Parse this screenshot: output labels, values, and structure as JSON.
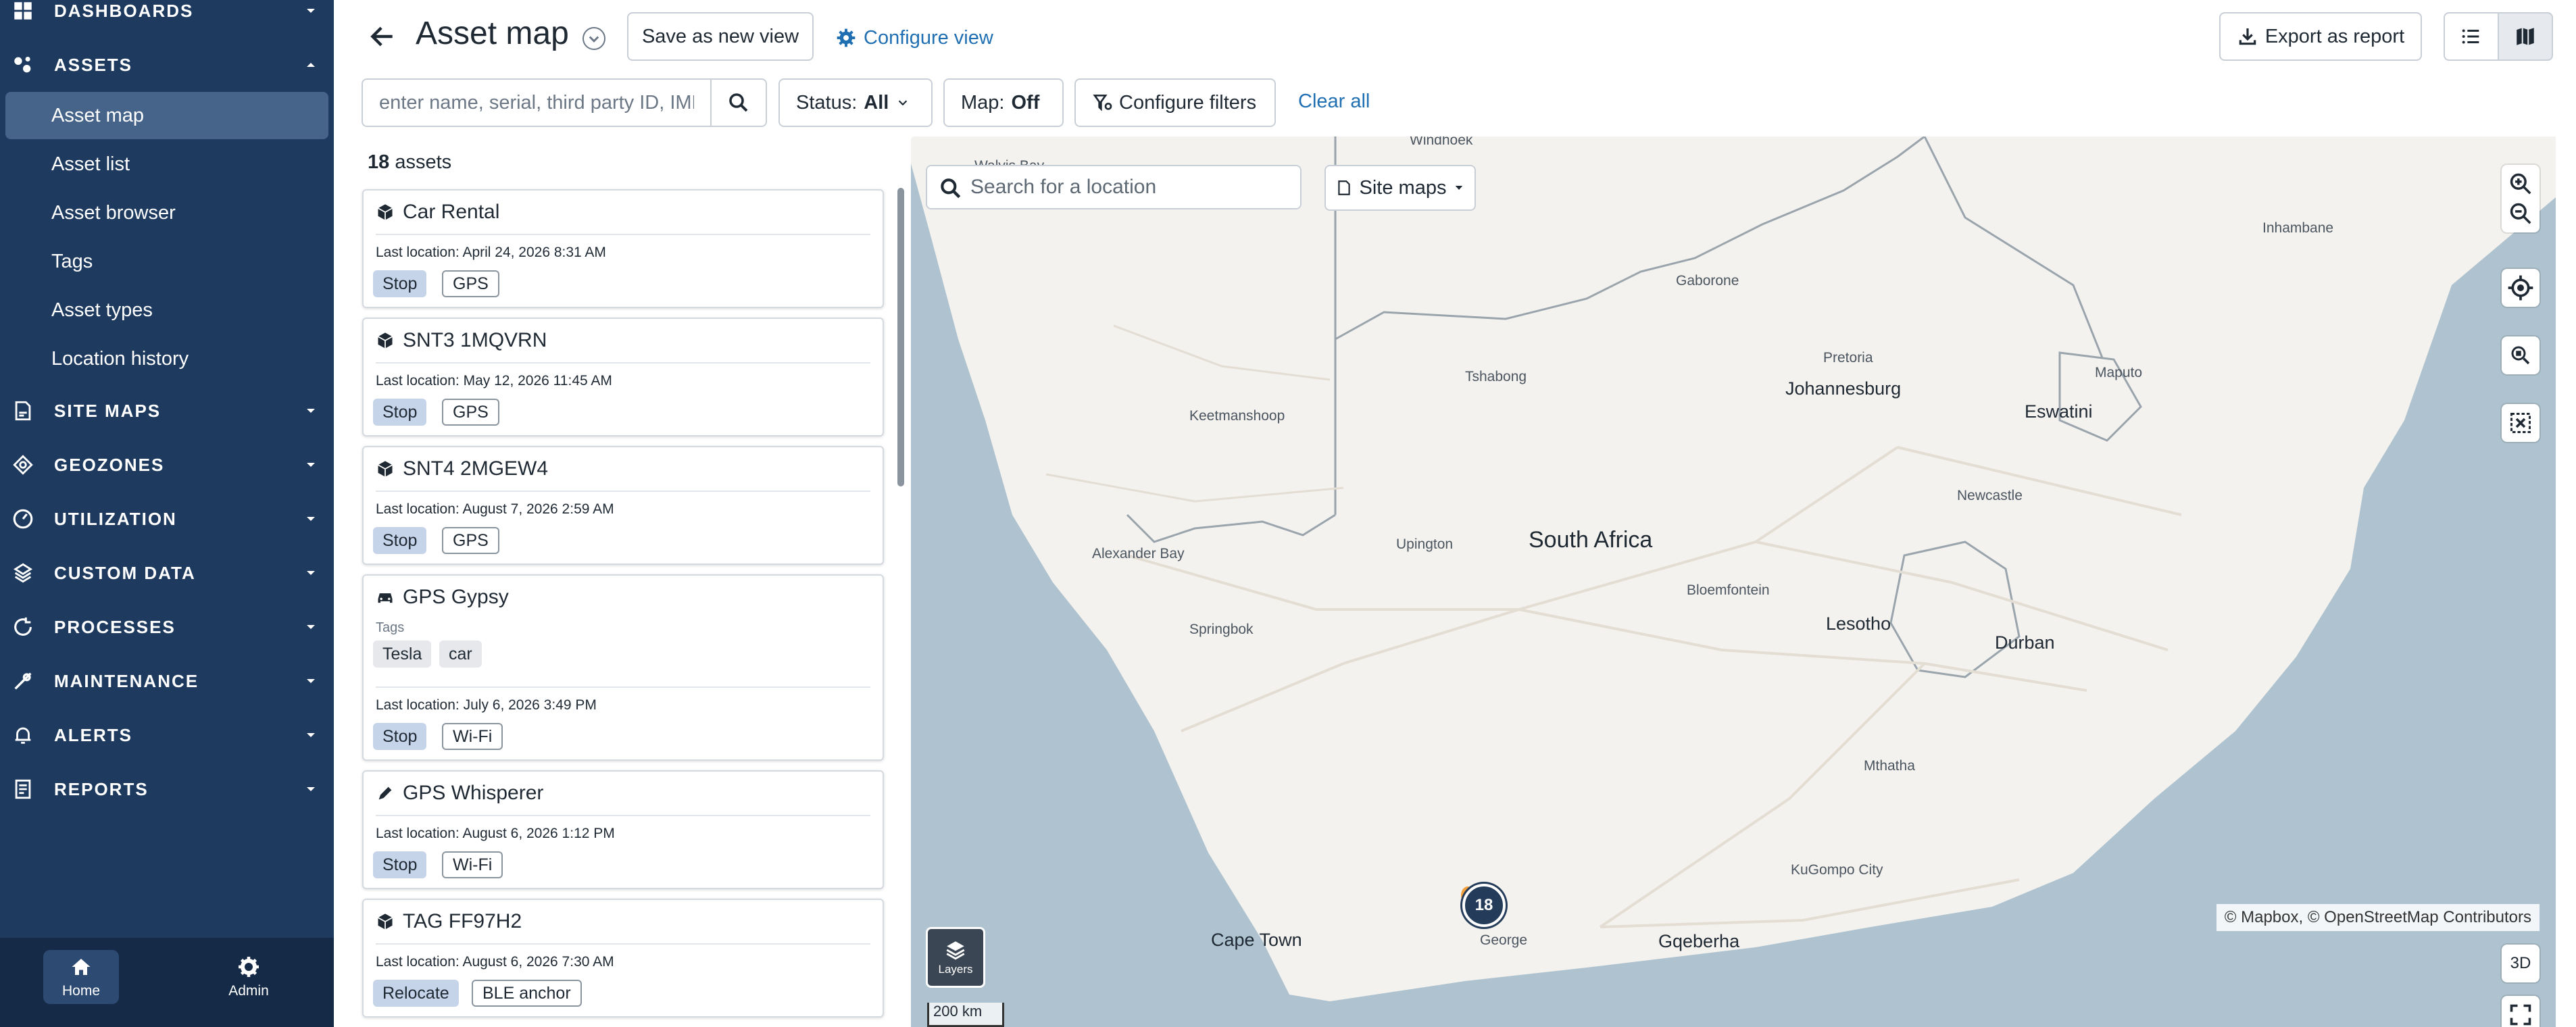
{
  "sidebar": {
    "sections": [
      {
        "key": "dashboards",
        "label": "DASHBOARDS",
        "icon": "grid-icon"
      },
      {
        "key": "assets",
        "label": "ASSETS",
        "icon": "assets-icon"
      },
      {
        "key": "site_maps",
        "label": "SITE MAPS",
        "icon": "site-maps-icon"
      },
      {
        "key": "geozones",
        "label": "GEOZONES",
        "icon": "geozones-icon"
      },
      {
        "key": "utilization",
        "label": "UTILIZATION",
        "icon": "utilization-icon"
      },
      {
        "key": "custom_data",
        "label": "CUSTOM DATA",
        "icon": "custom-data-icon"
      },
      {
        "key": "processes",
        "label": "PROCESSES",
        "icon": "processes-icon"
      },
      {
        "key": "maintenance",
        "label": "MAINTENANCE",
        "icon": "wrench-icon"
      },
      {
        "key": "alerts",
        "label": "ALERTS",
        "icon": "bell-icon"
      },
      {
        "key": "reports",
        "label": "REPORTS",
        "icon": "report-icon"
      }
    ],
    "asset_items": [
      {
        "label": "Asset map",
        "active": true
      },
      {
        "label": "Asset list"
      },
      {
        "label": "Asset browser"
      },
      {
        "label": "Tags"
      },
      {
        "label": "Asset types"
      },
      {
        "label": "Location history"
      }
    ],
    "bottom": {
      "home": "Home",
      "admin": "Admin"
    }
  },
  "header": {
    "title": "Asset map",
    "save_view": "Save as new view",
    "configure_view": "Configure view",
    "export": "Export as report",
    "view_modes": [
      "list-view-icon",
      "map-view-icon"
    ]
  },
  "filters": {
    "search_placeholder": "enter name, serial, third party ID, IMEI",
    "status_label": "Status:",
    "status_value": "All",
    "map_label": "Map:",
    "map_value": "Off",
    "configure_filters": "Configure filters",
    "clear_all": "Clear all"
  },
  "asset_list": {
    "count": "18",
    "count_label": "assets",
    "last_location_label": "Last location:",
    "tags_label": "Tags",
    "assets": [
      {
        "name": "Car Rental",
        "icon": "cube-icon",
        "last_location": "April 24, 2026 8:31 AM",
        "status": "Stop",
        "source": "GPS"
      },
      {
        "name": "SNT3 1MQVRN",
        "icon": "cube-icon",
        "last_location": "May 12, 2026 11:45 AM",
        "status": "Stop",
        "source": "GPS"
      },
      {
        "name": "SNT4 2MGEW4",
        "icon": "cube-icon",
        "last_location": "August 7, 2026 2:59 AM",
        "status": "Stop",
        "source": "GPS"
      },
      {
        "name": "GPS Gypsy",
        "icon": "car-icon",
        "tags": [
          "Tesla",
          "car"
        ],
        "last_location": "July 6, 2026 3:49 PM",
        "status": "Stop",
        "source": "Wi-Fi"
      },
      {
        "name": "GPS Whisperer",
        "icon": "pen-icon",
        "last_location": "August 6, 2026 1:12 PM",
        "status": "Stop",
        "source": "Wi-Fi"
      },
      {
        "name": "TAG FF97H2",
        "icon": "cube-icon",
        "last_location": "August 6, 2026 7:30 AM",
        "status": "Relocate",
        "source": "BLE anchor"
      }
    ]
  },
  "map": {
    "search_placeholder": "Search for a location",
    "site_maps": "Site maps",
    "cluster_count": "18",
    "attribution": "© Mapbox, © OpenStreetMap Contributors",
    "layers": "Layers",
    "scale": "200 km",
    "button_3d": "3D",
    "labels": {
      "windhoek": "Windhoek",
      "walvis": "Walvis Bay",
      "gaborone": "Gaborone",
      "inhambane": "Inhambane",
      "tshabong": "Tshabong",
      "pretoria": "Pretoria",
      "johannesburg": "Johannesburg",
      "maputo": "Maputo",
      "keetmanshoop": "Keetmanshoop",
      "eswatini": "Eswatini",
      "newcastle": "Newcastle",
      "alexander_bay": "Alexander Bay",
      "upington": "Upington",
      "south_africa": "South Africa",
      "bloemfontein": "Bloemfontein",
      "springbok": "Springbok",
      "lesotho": "Lesotho",
      "durban": "Durban",
      "mthatha": "Mthatha",
      "kugompo": "KuGompo City",
      "cape_town": "Cape Town",
      "george": "George",
      "gqeberha": "Gqeberha"
    }
  },
  "colors": {
    "sidebar": "#1e3a5f",
    "sidebar_active": "#46648a",
    "link": "#1f6fb2",
    "cluster": "#243b5a",
    "ocean": "#aec3cf",
    "land": "#f4f2ee"
  }
}
